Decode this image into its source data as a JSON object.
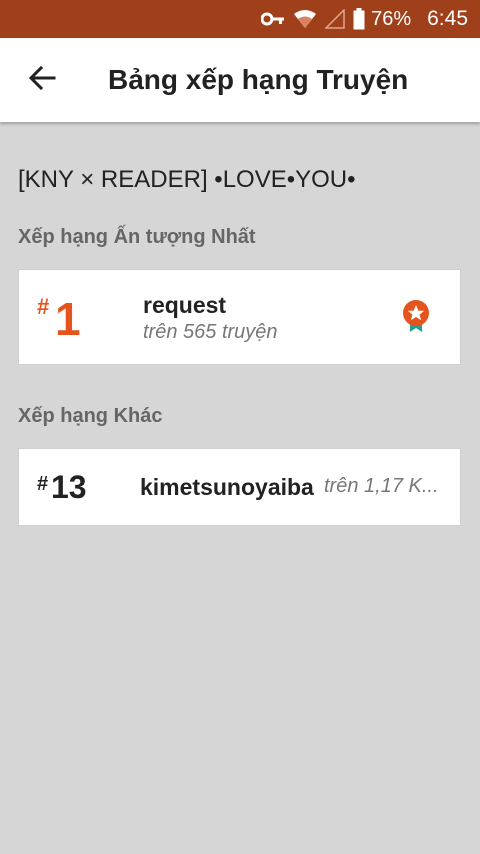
{
  "status_bar": {
    "battery_percent": "76%",
    "time": "6:45",
    "icons": [
      "key-icon",
      "wifi-icon",
      "signal-icon",
      "battery-icon"
    ]
  },
  "app_bar": {
    "title": "Bảng xếp hạng Truyện",
    "back_icon": "arrow-left-icon"
  },
  "story": {
    "title": "[KNY × READER] •LOVE•YOU•"
  },
  "sections": [
    {
      "title": "Xếp hạng Ấn tượng Nhất",
      "entries": [
        {
          "hash": "#",
          "rank": "1",
          "tag": "request",
          "subtitle": "trên 565 truyện",
          "badge_icon": "award-ribbon-icon"
        }
      ]
    },
    {
      "title": "Xếp hạng Khác",
      "entries": [
        {
          "hash": "#",
          "rank": "13",
          "tag": "kimetsunoyaiba",
          "subtitle": "trên 1,17 K..."
        }
      ]
    }
  ],
  "colors": {
    "status_bar": "#a0401b",
    "accent": "#e6541d",
    "background": "#d6d6d6",
    "badge_ribbon": "#2a9d8f"
  }
}
